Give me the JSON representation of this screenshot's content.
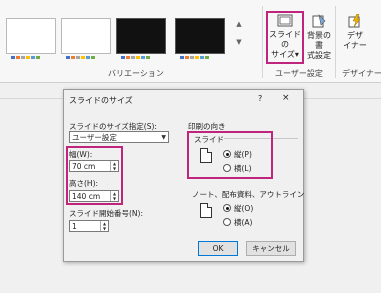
{
  "ribbon": {
    "group_variations_label": "バリエーション",
    "group_user_settings_label": "ユーザー設定",
    "group_designer_label": "デザイナー",
    "slide_size_button": {
      "line1": "スライドの",
      "line2": "サイズ▾"
    },
    "background_format_button": {
      "line1": "背景の書",
      "line2": "式設定"
    },
    "designer_button": {
      "line1": "デザ",
      "line2": "イナー"
    }
  },
  "dialog": {
    "title": "スライドのサイズ",
    "help": "?",
    "close": "×",
    "slide_size_for_label": "スライドのサイズ指定(S):",
    "slide_size_for_value": "ユーザー設定",
    "width_label": "幅(W):",
    "width_value": "70 cm",
    "height_label": "高さ(H):",
    "height_value": "140 cm",
    "start_number_label": "スライド開始番号(N):",
    "start_number_value": "1",
    "orientation_label": "印刷の向き",
    "slides_label": "スライド",
    "slides_portrait": "縦(P)",
    "slides_landscape": "横(L)",
    "notes_label": "ノート、配布資料、アウトライン",
    "notes_portrait": "縦(O)",
    "notes_landscape": "横(A)",
    "ok": "OK",
    "cancel": "キャンセル"
  },
  "colors": {
    "highlight": "#c0257d",
    "accent": "#0078d7"
  }
}
